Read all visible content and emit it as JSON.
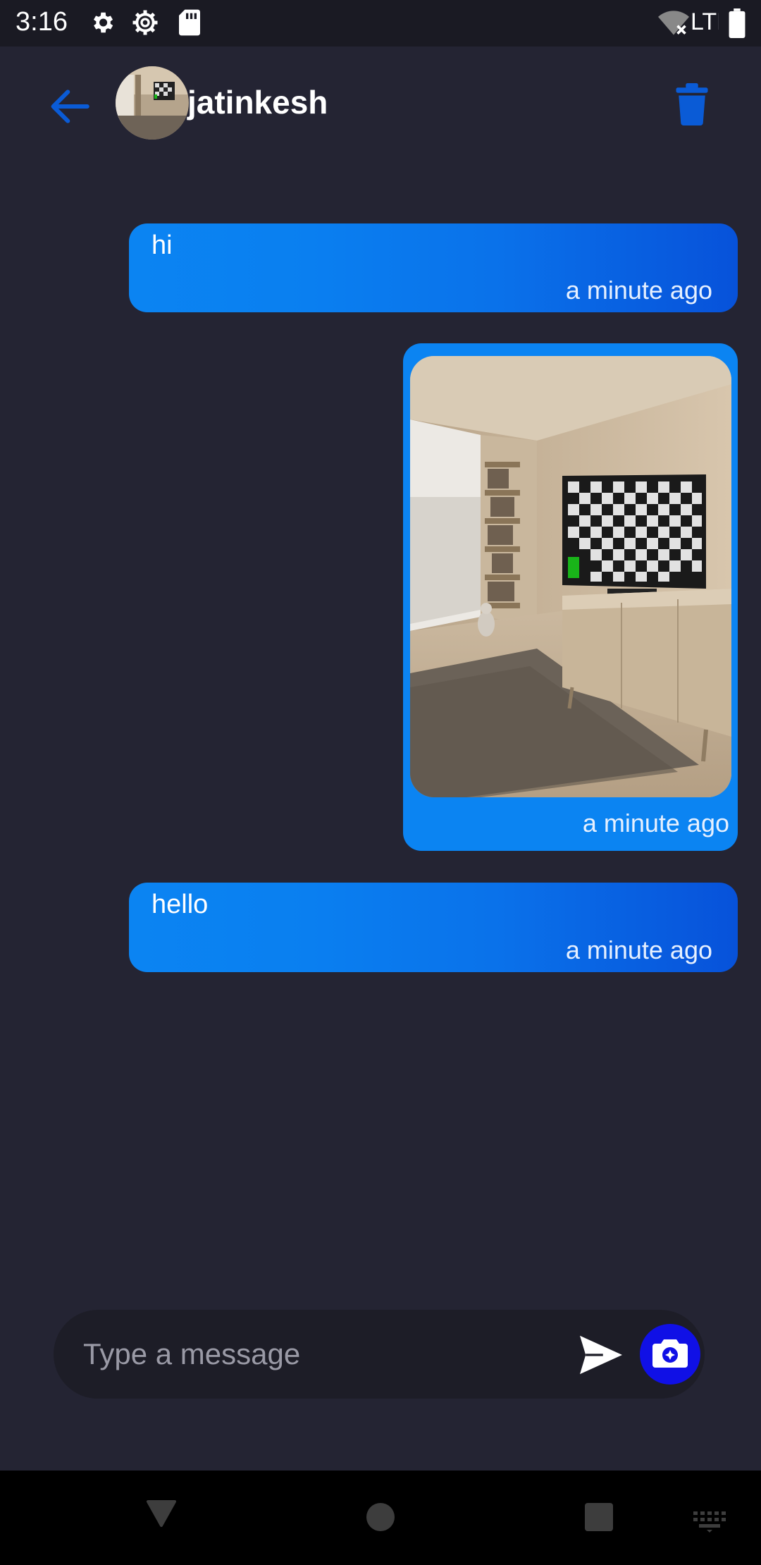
{
  "status_bar": {
    "time": "3:16",
    "network": "LTE",
    "icons": [
      "settings-icon",
      "settings-outline-icon",
      "sd-card-icon",
      "wifi-off-icon",
      "battery-icon"
    ]
  },
  "header": {
    "username": "jatinkesh",
    "back_icon": "arrow-left-icon",
    "delete_icon": "trash-icon",
    "accent_color": "#0a5bd6"
  },
  "messages": [
    {
      "type": "text",
      "text": "hi",
      "time": "a minute ago"
    },
    {
      "type": "image",
      "time": "a minute ago"
    },
    {
      "type": "text",
      "text": "hello",
      "time": "a minute ago"
    }
  ],
  "composer": {
    "placeholder": "Type a message",
    "value": "",
    "send_icon": "send-icon",
    "camera_icon": "camera-icon"
  },
  "colors": {
    "background": "#242433",
    "bubble": "#0b84f2",
    "bubble_gradient_end": "#0752da",
    "camera_button": "#1010e6"
  }
}
